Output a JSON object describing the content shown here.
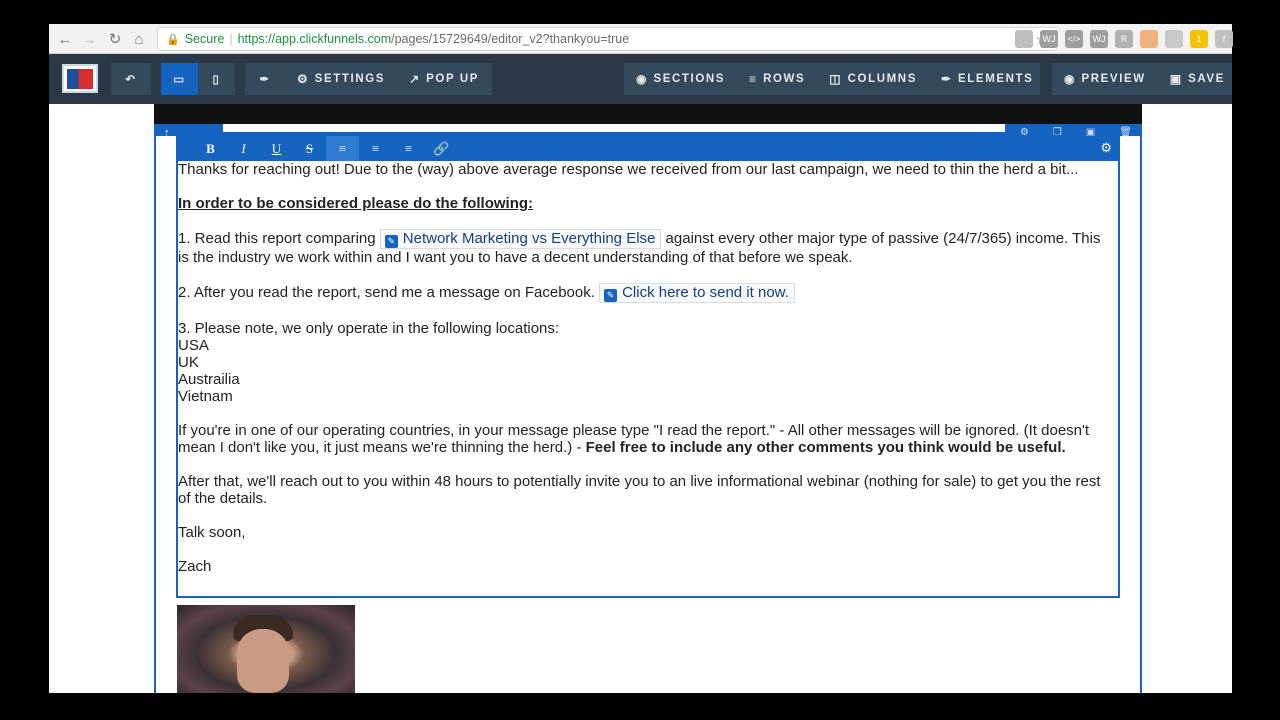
{
  "browser": {
    "secure_label": "Secure",
    "url_host": "https://app.clickfunnels.com",
    "url_path": "/pages/15729649/editor_v2?thankyou=true",
    "extensions": [
      {
        "name": "cloud-extension-icon",
        "label": "",
        "color": "#bdbdbd"
      },
      {
        "name": "wj-extension-icon",
        "label": "WJ",
        "color": "#9e9e9e"
      },
      {
        "name": "code-extension-icon",
        "label": "</>",
        "color": "#9e9e9e"
      },
      {
        "name": "wj2-extension-icon",
        "label": "WJ",
        "color": "#9e9e9e"
      },
      {
        "name": "r-extension-icon",
        "label": "R",
        "color": "#b0b0b0"
      },
      {
        "name": "tag-extension-icon",
        "label": "",
        "color": "#f0b27a"
      },
      {
        "name": "puzzle-extension-icon",
        "label": "",
        "color": "#c8c8c8"
      },
      {
        "name": "folder-extension-icon",
        "label": "1",
        "color": "#f2c200"
      },
      {
        "name": "f-extension-icon",
        "label": "f",
        "color": "#c0c0c0"
      }
    ]
  },
  "toolbar": {
    "settings": "SETTINGS",
    "popup": "POP UP",
    "sections": "SECTIONS",
    "rows": "ROWS",
    "columns": "COLUMNS",
    "elements": "ELEMENTS",
    "preview": "PREVIEW",
    "save": "SAVE"
  },
  "rte": {
    "bold": "B",
    "italic": "I",
    "underline": "U",
    "strike": "S"
  },
  "content": {
    "p1": "Thanks for reaching out! Due to the (way) above average response we received from our last campaign, we need to thin the herd a bit...",
    "heading": "In order to be considered please do the following: ",
    "step1_a": "1. Read this report comparing ",
    "step1_link": "Network Marketing vs Everything Else",
    "step1_b": " against every other major type of passive (24/7/365) income. This is the industry we work within and I want you to have a decent understanding of that before we speak.",
    "step2_a": "2. After you read the report, send me a message on Facebook. ",
    "step2_link": "Click here to send it now.",
    "step3": "3. Please note, we only operate in the following locations:",
    "locations": [
      "USA",
      "UK",
      "Austrailia",
      "Vietnam"
    ],
    "p_message_a": "If you're in one of our operating countries, in your message please type \"I read the report.\" - All other messages will be ignored. (It doesn't mean I don't like you, it just means we're thinning the herd.) - ",
    "p_message_bold": "Feel free to include any other comments you think would be useful.",
    "p_after": "After that, we'll reach out to you within 48 hours to potentially invite you to an live informational webinar (nothing for sale) to get you the rest of the details.",
    "signoff": "Talk soon,",
    "name": "Zach"
  }
}
